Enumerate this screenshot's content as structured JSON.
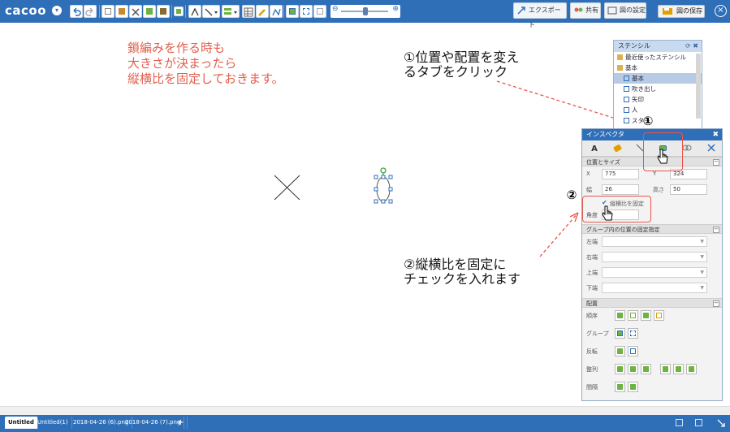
{
  "app": {
    "logo": "cacoo",
    "logo_menu": "▾"
  },
  "toolbar": {
    "export_label": "エクスポート",
    "share_label": "共有",
    "settings_label": "図の設定",
    "save_label": "図の保存",
    "close_label": "×"
  },
  "canvas": {
    "red_note": [
      "鎖編みを作る時も",
      "大きさが決まったら",
      "縦横比を固定しておきます。"
    ],
    "note1": [
      "①位置や配置を変え",
      "るタブをクリック"
    ],
    "note2": [
      "②縦横比を固定に",
      "チェックを入れます"
    ],
    "marker1": "①",
    "marker2": "②"
  },
  "stencil": {
    "title": "ステンシル",
    "header_icons": "⟳ ✖",
    "items": [
      {
        "label": "最近使ったステンシル",
        "level": 0
      },
      {
        "label": "基本",
        "level": 0
      },
      {
        "label": "基本",
        "level": 1,
        "selected": true
      },
      {
        "label": "吹き出し",
        "level": 1
      },
      {
        "label": "矢印",
        "level": 1
      },
      {
        "label": "人",
        "level": 1
      },
      {
        "label": "スター",
        "level": 1
      }
    ]
  },
  "inspector": {
    "title": "インスペクタ",
    "close": "✖",
    "tabs": [
      "A",
      "",
      "",
      "",
      "",
      ""
    ],
    "section_position": "位置とサイズ",
    "x_label": "X",
    "x_value": "775",
    "y_label": "Y",
    "y_value": "324",
    "w_label": "幅",
    "w_value": "26",
    "h_label": "高さ",
    "h_value": "50",
    "lock_ratio_label": "縦横比を固定",
    "lock_ratio_checked": true,
    "angle_label": "角度",
    "section_group": "グループ内の位置の固定指定",
    "group_rows": [
      "左端",
      "右端",
      "上端",
      "下端"
    ],
    "section_arrange": "配置",
    "arrange_rows": [
      {
        "label": "順序",
        "buttons": 4
      },
      {
        "label": "グループ",
        "buttons": 2
      },
      {
        "label": "反転",
        "buttons": 2
      },
      {
        "label": "整列",
        "buttons": 6
      },
      {
        "label": "間隔",
        "buttons": 2
      }
    ],
    "collapse_symbol": "−"
  },
  "bottom_tabs": [
    {
      "label": "Untitled",
      "active": true
    },
    {
      "label": "Untitled(1)",
      "active": false
    },
    {
      "label": "2018-04-26 (6).png",
      "active": false
    },
    {
      "label": "2018-04-26 (7).png",
      "active": false
    }
  ],
  "add_tab": "+",
  "colors": {
    "brand": "#2f6fb8",
    "annotation_red": "#e0604e",
    "highlight": "#e8544b",
    "icon_green": "#6db33f"
  }
}
